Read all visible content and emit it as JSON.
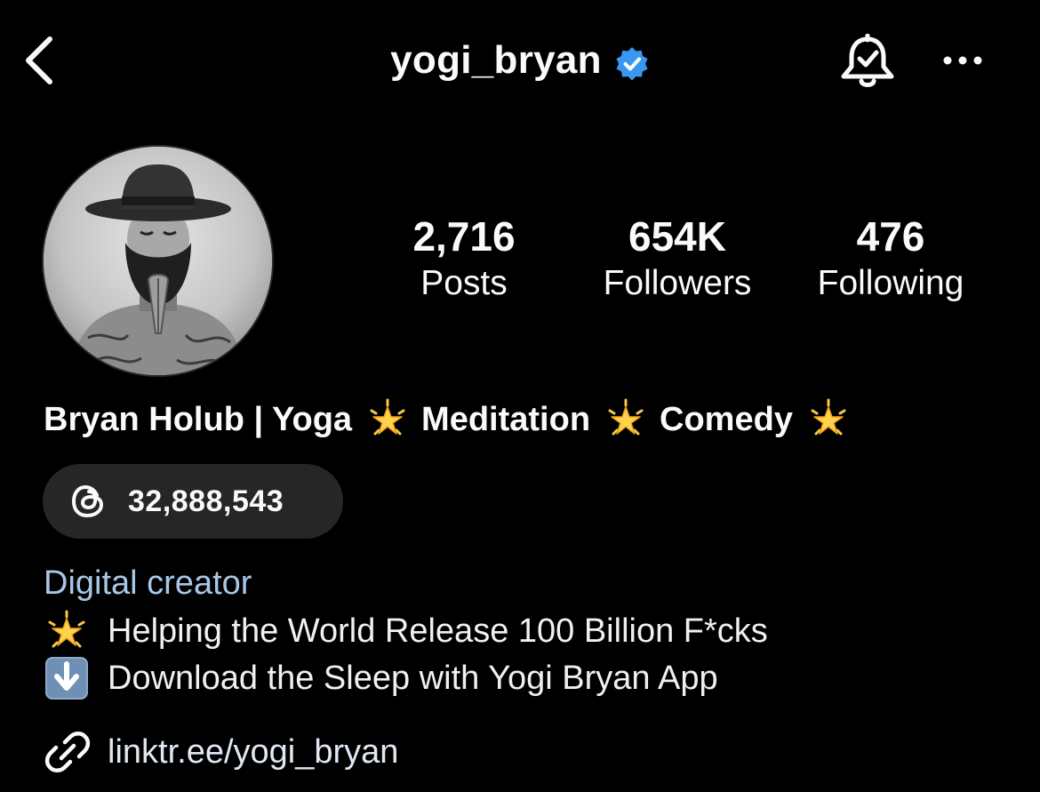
{
  "header": {
    "username": "yogi_bryan",
    "back_icon": "chevron-left-icon",
    "verified_icon": "verified-badge-icon",
    "bell_icon": "notification-bell-icon",
    "more_icon": "more-horizontal-icon",
    "verified_color": "#3897f0"
  },
  "profile": {
    "avatar": "profile-photo"
  },
  "stats": [
    {
      "value": "2,716",
      "label": "Posts"
    },
    {
      "value": "654K",
      "label": "Followers"
    },
    {
      "value": "476",
      "label": "Following"
    }
  ],
  "name_line": {
    "parts": [
      "Bryan Holub | Yoga",
      "Meditation",
      "Comedy"
    ],
    "emoji": "glowing-star-icon"
  },
  "threads": {
    "icon": "threads-icon",
    "count": "32,888,543"
  },
  "bio": {
    "category": "Digital creator",
    "lines": [
      {
        "emoji": "glowing-star-icon",
        "text": "Helping the World Release 100 Billion F*cks"
      },
      {
        "emoji": "down-arrow-icon",
        "text": "Download the Sleep with Yogi Bryan App"
      }
    ],
    "link": {
      "icon": "link-icon",
      "text": "linktr.ee/yogi_bryan"
    },
    "category_color": "#a8c7e6"
  }
}
